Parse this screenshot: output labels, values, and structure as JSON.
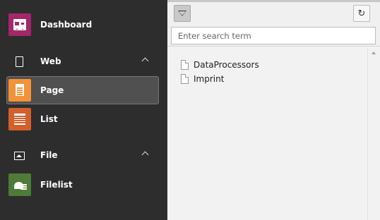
{
  "sidebar": {
    "modules": [
      {
        "label": "Dashboard",
        "icon": "dashboard-icon",
        "color": "#a4276a"
      }
    ],
    "groups": [
      {
        "label": "Web",
        "icon": "document-icon",
        "expanded": true,
        "items": [
          {
            "label": "Page",
            "icon": "page-icon",
            "color": "#f49237",
            "active": true
          },
          {
            "label": "List",
            "icon": "list-icon",
            "color": "#d2602b",
            "active": false
          }
        ]
      },
      {
        "label": "File",
        "icon": "image-icon",
        "expanded": true,
        "items": [
          {
            "label": "Filelist",
            "icon": "filelist-icon",
            "color": "#4f7a38",
            "active": false
          }
        ]
      }
    ]
  },
  "tree": {
    "filter_button": {
      "icon": "filter-icon",
      "active": true
    },
    "refresh_button": {
      "icon": "refresh-icon"
    },
    "search": {
      "placeholder": "Enter search term",
      "value": ""
    },
    "nodes": [
      {
        "label": "DataProcessors",
        "icon": "page-icon"
      },
      {
        "label": "Imprint",
        "icon": "page-icon"
      }
    ]
  }
}
